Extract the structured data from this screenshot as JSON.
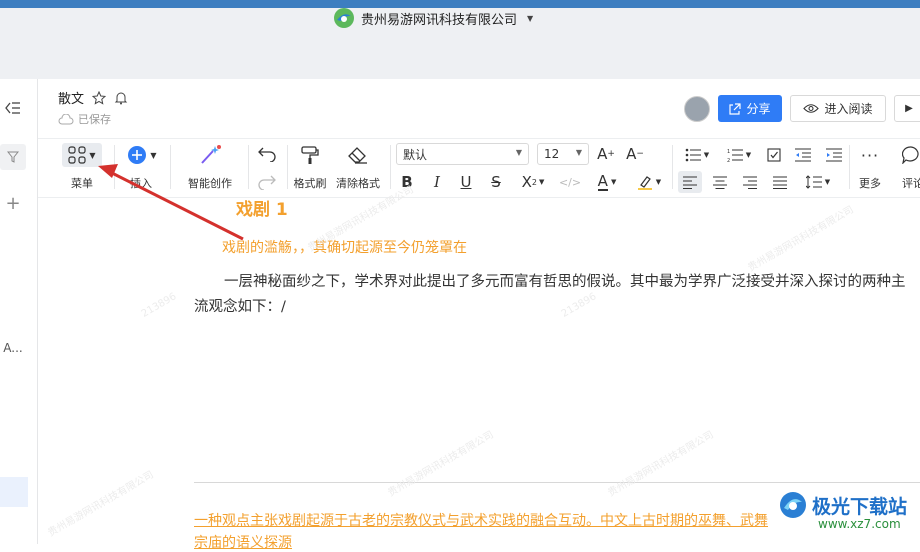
{
  "app": {
    "org_name": "贵州易游网讯科技有限公司"
  },
  "document": {
    "title": "散文",
    "save_status": "已保存",
    "heading1": "戏剧 1",
    "heading2": "戏剧的滥觞，，其确切起源至今仍笼罩在",
    "paragraph": "一层神秘面纱之下，学术界对此提出了多元而富有哲思的假说。其中最为学界广泛接受并深入探讨的两种主流观念如下：/",
    "linked_line1": "一种观点主张戏剧起源于古老的宗教仪式与武术实践的融合互动。中文上古时期的巫舞、武舞",
    "linked_line2": "宗庙的语义探源"
  },
  "header_actions": {
    "share_label": "分享",
    "read_mode_label": "进入阅读"
  },
  "toolbar": {
    "menu_label": "菜单",
    "insert_label": "插入",
    "ai_label": "智能创作",
    "format_painter_label": "格式刷",
    "clear_format_label": "清除格式",
    "font_family_value": "默认",
    "font_size_value": "12",
    "more_label": "更多",
    "comment_label": "评论"
  },
  "watermark": {
    "text": "贵州易游网讯科技有限公司",
    "code": "213896"
  },
  "brand_overlay": {
    "name": "极光下载站",
    "url": "www.xz7.com"
  },
  "colors": {
    "accent": "#2f7cf6",
    "heading": "#f3a02e",
    "annotation_arrow": "#d4312d"
  }
}
